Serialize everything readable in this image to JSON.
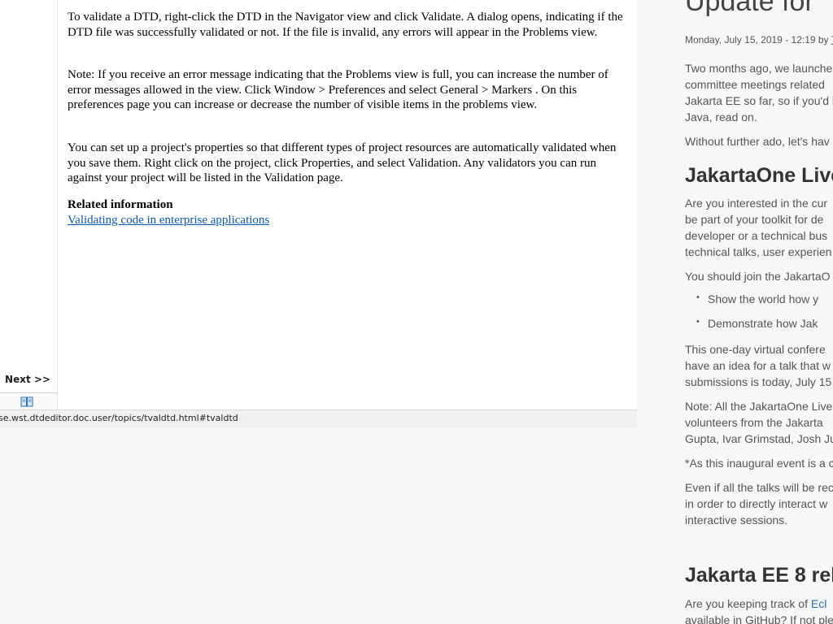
{
  "help": {
    "paragraphs": [
      "To validate a DTD, right-click the DTD in the Navigator view and click Validate. A dialog opens, indicating if the DTD file was successfully validated or not. If the file is invalid, any errors will appear in the Problems view.",
      "Note: If you receive an error message indicating that the Problems view is full, you can increase the number of error messages allowed in the view. Click Window > Preferences and select General > Markers . On this preferences page you can increase or decrease the number of visible items in the problems view.",
      "You can set up a project's properties so that different types of project resources are automatically validated when you save them. Right click on the project, click Properties, and select Validation. Any validators you can run against your project will be listed in the Validation page."
    ],
    "related_heading": "Related information",
    "related_link": "Validating code in enterprise applications",
    "next_label": "Next >>",
    "status_url": "se.wst.dtdeditor.doc.user/topics/tvaldtd.html#tvaldtd"
  },
  "blog": {
    "title": "Update for",
    "meta_date": "Monday, July 15, 2019 - 12:19 by ",
    "meta_author": "T",
    "intro_lines": [
      "Two months ago, we launche",
      "committee meetings related",
      "Jakarta EE so far, so if you'd ",
      "Java, read on."
    ],
    "intro_link": "l",
    "intro2": "Without further ado, let's hav",
    "section1_title": "JakartaOne Live",
    "section1_lines": [
      "Are you interested in the cur",
      "be part of your toolkit for de",
      "developer or a technical bus",
      "technical talks, user experien"
    ],
    "join_line": "You should join the JakartaO",
    "bullets": [
      "Show the world how y",
      "Demonstrate how Jak"
    ],
    "conf_lines": [
      "This one-day virtual confere",
      "have an idea for a talk that w",
      "submissions is today, July 15"
    ],
    "note_lines": [
      "Note: All the JakartaOne Live",
      "volunteers from the Jakarta",
      "Gupta, Ivar Grimstad, Josh Ju"
    ],
    "footnote": "*As this inaugural event is a c",
    "even_lines": [
      "Even if all the talks will be rec",
      "in order to directly interact w",
      "interactive sessions."
    ],
    "section2_title": "Jakarta EE 8 rele",
    "tracking_prefix": "Are you keeping track of ",
    "tracking_link": "Ecl",
    "tracking_line2": "available in GitHub? If not ple"
  }
}
